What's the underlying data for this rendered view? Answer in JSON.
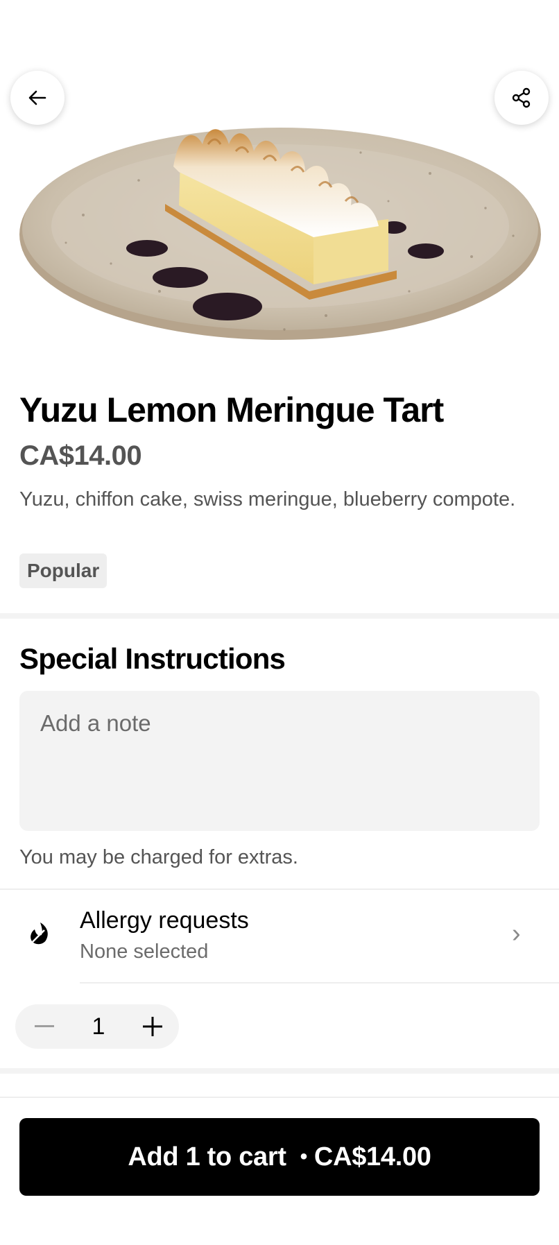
{
  "header": {
    "back_icon": "arrow-left-icon",
    "share_icon": "share-icon"
  },
  "item": {
    "name": "Yuzu Lemon Meringue Tart",
    "price": "CA$14.00",
    "description": "Yuzu, chiffon cake, swiss meringue, blueberry compote.",
    "badge": "Popular"
  },
  "special_instructions": {
    "title": "Special Instructions",
    "placeholder": "Add a note",
    "note": "You may be charged for extras."
  },
  "allergy": {
    "icon": "allergy-icon",
    "title": "Allergy requests",
    "subtitle": "None selected",
    "chevron": "›"
  },
  "quantity": {
    "value": "1",
    "minus_icon": "minus-icon",
    "plus_icon": "plus-icon"
  },
  "cart_button": {
    "label": "Add 1 to cart",
    "separator": "•",
    "price": "CA$14.00"
  },
  "colors": {
    "primary": "#000000",
    "secondary_text": "#545454",
    "surface": "#f3f3f3"
  }
}
